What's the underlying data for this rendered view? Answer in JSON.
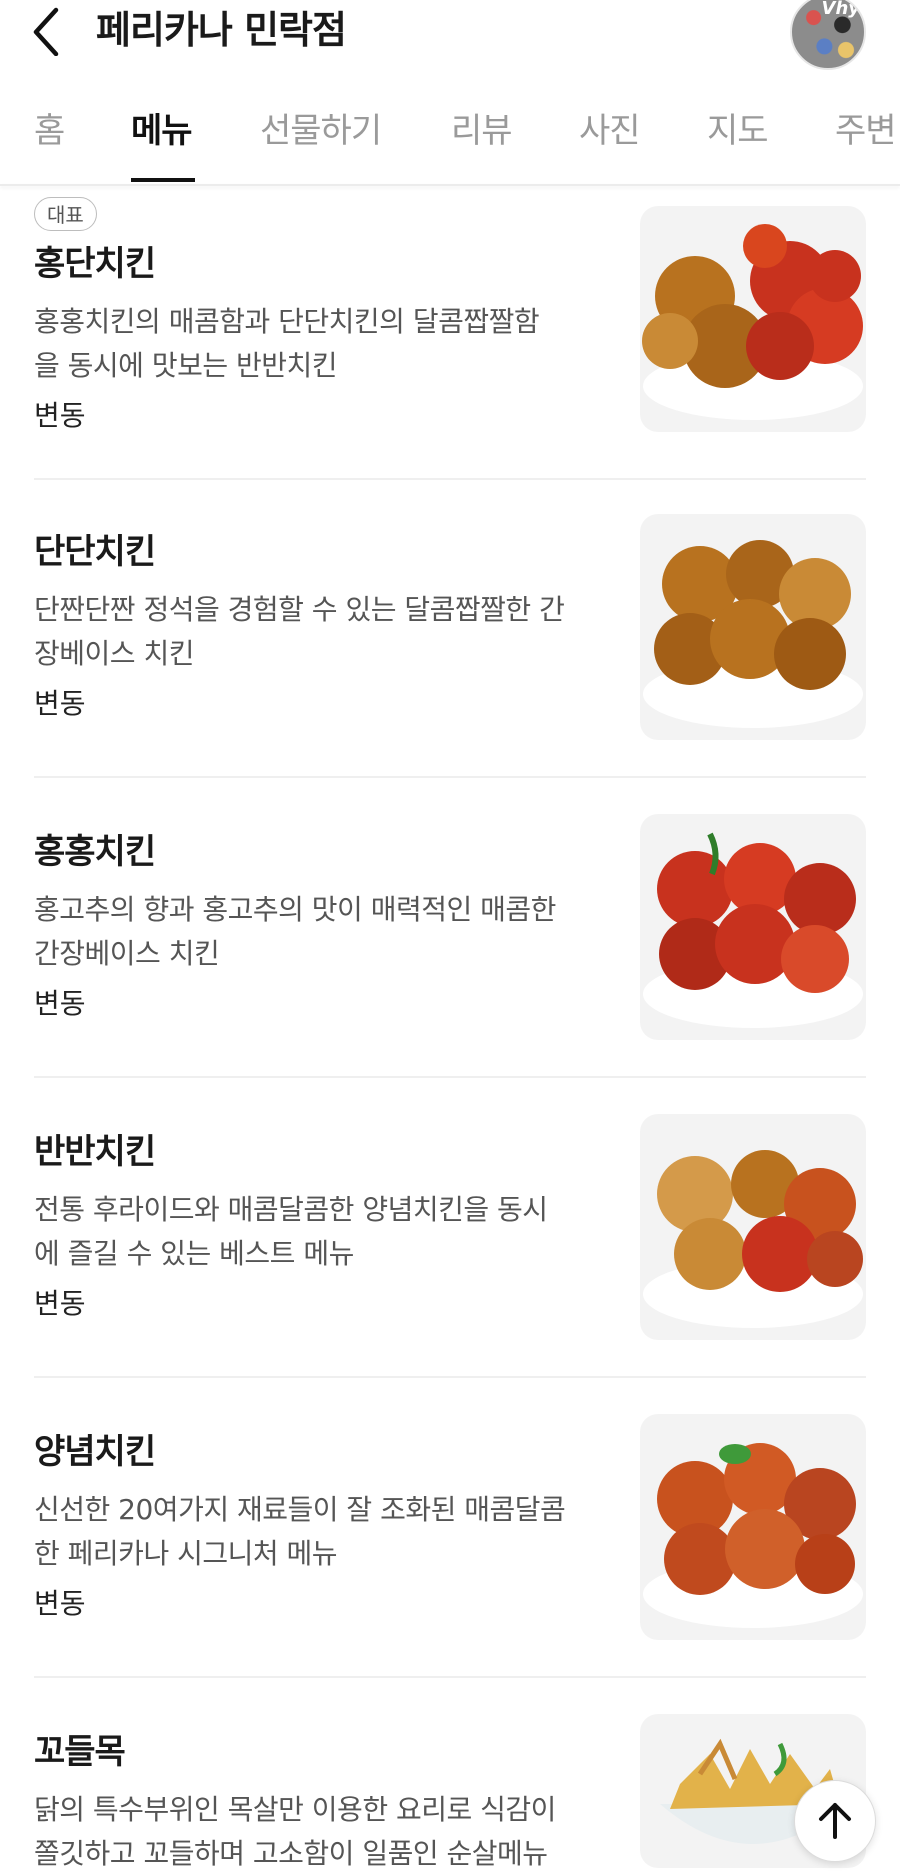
{
  "header": {
    "title": "페리카나 민락점",
    "avatar_text": "Vhy"
  },
  "tabs": [
    {
      "label": "홈"
    },
    {
      "label": "메뉴",
      "active": true
    },
    {
      "label": "선물하기"
    },
    {
      "label": "리뷰"
    },
    {
      "label": "사진"
    },
    {
      "label": "지도"
    },
    {
      "label": "주변"
    }
  ],
  "menu": {
    "items": [
      {
        "badge": "대표",
        "name": "홍단치킨",
        "desc_line1": "홍홍치킨의 매콤함과 단단치킨의 달콤짭짤함",
        "desc_line2": "을 동시에 맛보는 반반치킨",
        "price": "변동",
        "image": "honeydan-chicken-photo"
      },
      {
        "name": "단단치킨",
        "desc_line1": "단짠단짠 정석을 경험할 수 있는 달콤짭짤한 간",
        "desc_line2": "장베이스 치킨",
        "price": "변동",
        "image": "dandan-chicken-photo"
      },
      {
        "name": "홍홍치킨",
        "desc_line1": "홍고추의 향과 홍고추의 맛이 매력적인 매콤한",
        "desc_line2": "간장베이스 치킨",
        "price": "변동",
        "image": "honghong-chicken-photo"
      },
      {
        "name": "반반치킨",
        "desc_line1": "전통 후라이드와 매콤달콤한 양념치킨을 동시",
        "desc_line2": "에 즐길 수 있는 베스트 메뉴",
        "price": "변동",
        "image": "banban-chicken-photo"
      },
      {
        "name": "양념치킨",
        "desc_line1": "신선한 20여가지 재료들이 잘 조화된 매콤달콤",
        "desc_line2": "한 페리카나 시그니처 메뉴",
        "price": "변동",
        "image": "yangnyeom-chicken-photo"
      },
      {
        "name": "꼬들목",
        "desc_line1": "닭의 특수부위인 목살만 이용한 요리로 식감이",
        "desc_line2": "쫄깃하고 꼬들하며 고소함이 일품인 순살메뉴",
        "price": "",
        "image": "kkodeulmok-photo"
      }
    ]
  },
  "colors": {
    "text": "#1a1a1a",
    "muted": "#9a9a9a",
    "desc": "#555555",
    "sauce_red": "#c8321e",
    "glaze_brown": "#b8721f"
  },
  "icons": {
    "back": "chevron-left-icon",
    "scroll_top": "arrow-up-icon"
  }
}
